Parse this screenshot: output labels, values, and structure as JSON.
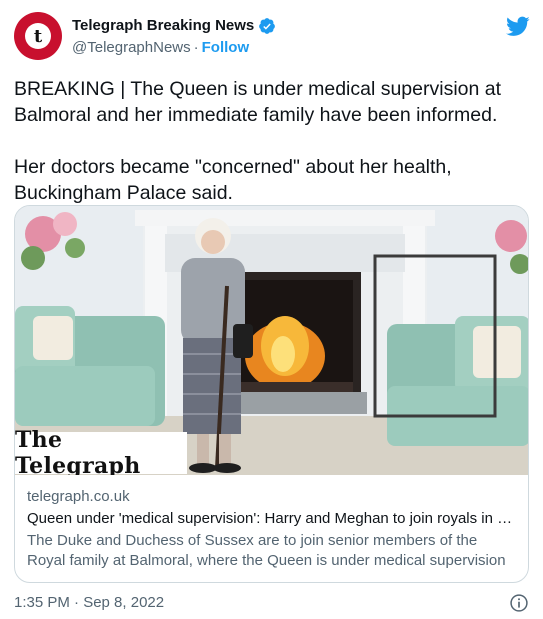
{
  "account": {
    "display_name": "Telegraph Breaking News",
    "handle": "@TelegraphNews",
    "separator": "·",
    "follow_label": "Follow",
    "avatar_letter": "t"
  },
  "tweet": {
    "paragraphs": [
      "BREAKING | The Queen is under medical supervision at Balmoral and her immediate family have been informed.",
      "Her doctors became \"concerned\" about her health, Buckingham Palace said."
    ]
  },
  "card": {
    "image_brand": "The Telegraph",
    "domain": "telegraph.co.uk",
    "title": "Queen under 'medical supervision': Harry and Meghan to join royals in B…",
    "description": "The Duke and Duchess of Sussex are to join senior members of the Royal family at Balmoral, where the Queen is under medical supervision …"
  },
  "footer": {
    "timestamp": "1:35 PM · Sep 8, 2022"
  },
  "icons": {
    "verified": "verified-badge-icon",
    "twitter": "twitter-bird-icon",
    "info": "info-icon"
  },
  "colors": {
    "accent": "#1d9bf0",
    "brand_red": "#c8102e",
    "text": "#0f1419",
    "secondary": "#536471",
    "border": "#cfd9de"
  }
}
